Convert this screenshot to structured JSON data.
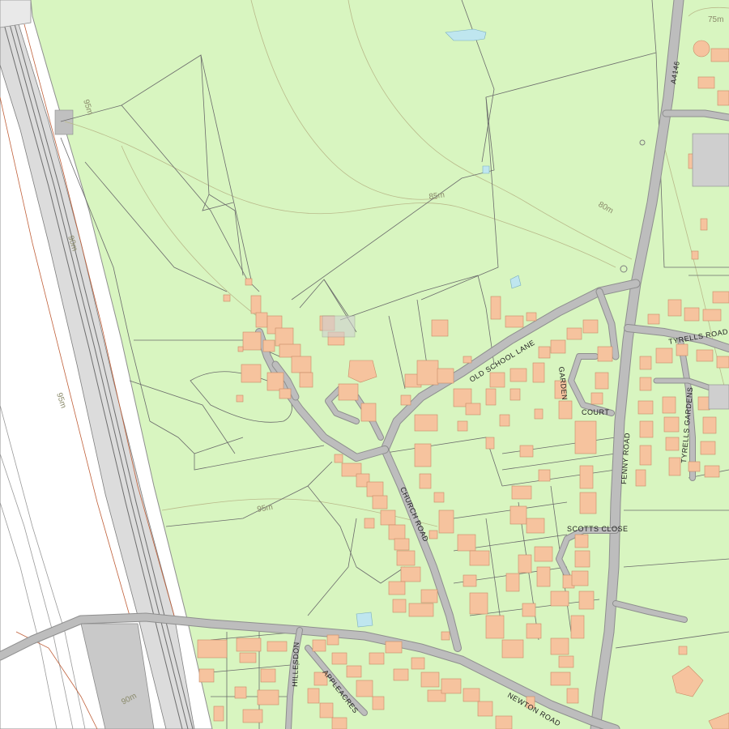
{
  "map": {
    "colors": {
      "land": "#d8f5c0",
      "road": "#bdbdbd",
      "building": "#f6c39e",
      "water": "#bfe6ef",
      "field_boundary": "#6b6b6b",
      "contour": "#b9b98a",
      "railway": "#8a8a8a"
    },
    "road_labels": {
      "a4146": "A4146",
      "old_school_lane": "OLD SCHOOL LANE",
      "tyrells_road": "TYRELLS ROAD",
      "garden_court_1": "GARDEN",
      "garden_court_2": "COURT",
      "fenny_road": "FENNY ROAD",
      "tyrells_gardens": "TYRELLS GARDENS",
      "church_road": "CHURCH ROAD",
      "scotts_close": "SCOTTS CLOSE",
      "newton_road": "NEWTON ROAD",
      "appleacres": "APPLEACRES",
      "hillesdon": "HILLESDON"
    },
    "contour_labels": {
      "c75": "75m",
      "c95_top": "95m",
      "c85": "85m",
      "c80": "80m",
      "c90_rail": "90m",
      "c95_rail": "95m",
      "c95_mid": "95m",
      "c90_bottom": "90m"
    }
  }
}
